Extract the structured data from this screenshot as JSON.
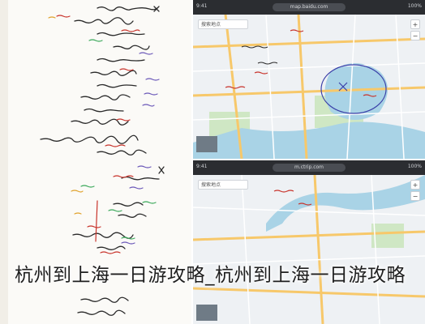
{
  "caption": "杭州到上海一日游攻略_杭州到上海一日游攻略",
  "browser_top": {
    "time": "9:41",
    "url": "map.baidu.com",
    "status": "100%"
  },
  "browser_bottom": {
    "time": "9:41",
    "url": "m.ctrip.com",
    "status": "100%"
  },
  "map_top": {
    "search_placeholder": "搜索地点",
    "zoom_in": "+",
    "zoom_out": "−"
  },
  "map_bottom": {
    "search_placeholder": "搜索地点",
    "zoom_in": "+",
    "zoom_out": "−"
  },
  "colors": {
    "ink_dark": "#2a2a2a",
    "ink_red": "#c8322a",
    "ink_purple": "#6a57b8",
    "ink_green": "#3aa85a",
    "water": "#a9d3e6",
    "park": "#cfe7c4",
    "road": "#f7c86a"
  }
}
